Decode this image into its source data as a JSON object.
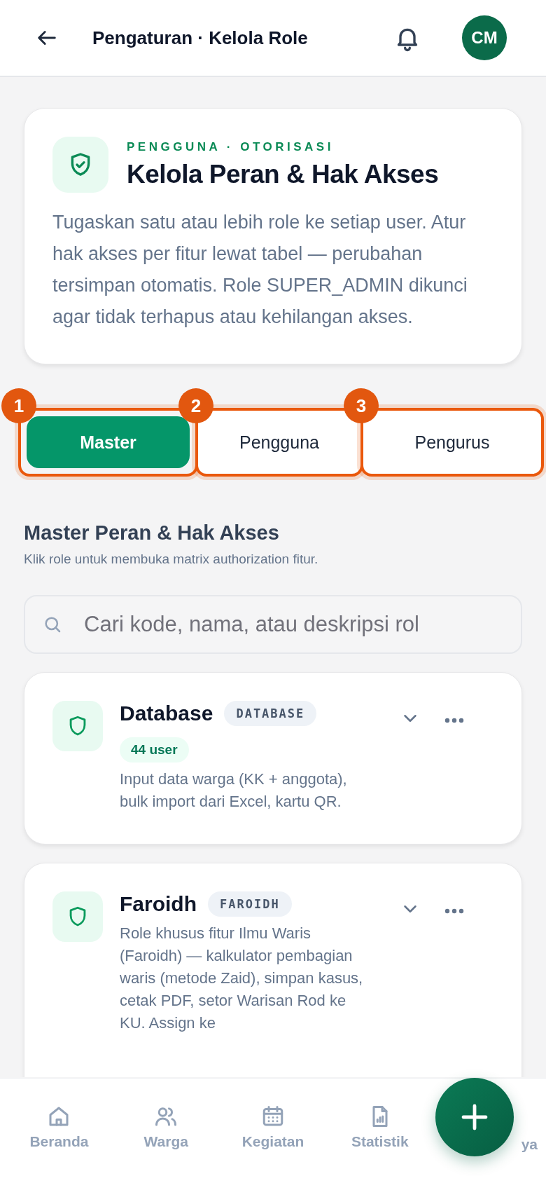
{
  "header": {
    "title": "Pengaturan · Kelola Role",
    "avatar": "CM"
  },
  "hero": {
    "eyebrow": "PENGGUNA · OTORISASI",
    "title": "Kelola Peran & Hak Akses",
    "description": "Tugaskan satu atau lebih role ke setiap user. Atur hak akses per fitur lewat tabel — perubahan tersimpan otomatis. Role SUPER_ADMIN dikunci agar tidak terhapus atau kehilangan akses."
  },
  "tabs": [
    {
      "label": "Master",
      "selected": true,
      "marker": "1"
    },
    {
      "label": "Pengguna",
      "selected": false,
      "marker": "2"
    },
    {
      "label": "Pengurus",
      "selected": false,
      "marker": "3"
    }
  ],
  "section": {
    "title": "Master Peran & Hak Akses",
    "subtitle": "Klik role untuk membuka matrix authorization fitur."
  },
  "search": {
    "placeholder": "Cari kode, nama, atau deskripsi rol"
  },
  "roles": [
    {
      "name": "Database",
      "code": "DATABASE",
      "users": "44 user",
      "description": "Input data warga (KK + anggota), bulk import dari Excel, kartu QR."
    },
    {
      "name": "Faroidh",
      "code": "FAROIDH",
      "description": "Role khusus fitur Ilmu Waris (Faroidh) — kalkulator pembagian waris (metode Zaid), simpan kasus, cetak PDF, setor Warisan Rod ke KU. Assign ke"
    }
  ],
  "nav": [
    {
      "label": "Beranda",
      "kind": "home"
    },
    {
      "label": "Warga",
      "kind": "users"
    },
    {
      "label": "Kegiatan",
      "kind": "calendar"
    },
    {
      "label": "Statistik",
      "kind": "report"
    },
    {
      "label": "ya",
      "kind": "text"
    }
  ]
}
